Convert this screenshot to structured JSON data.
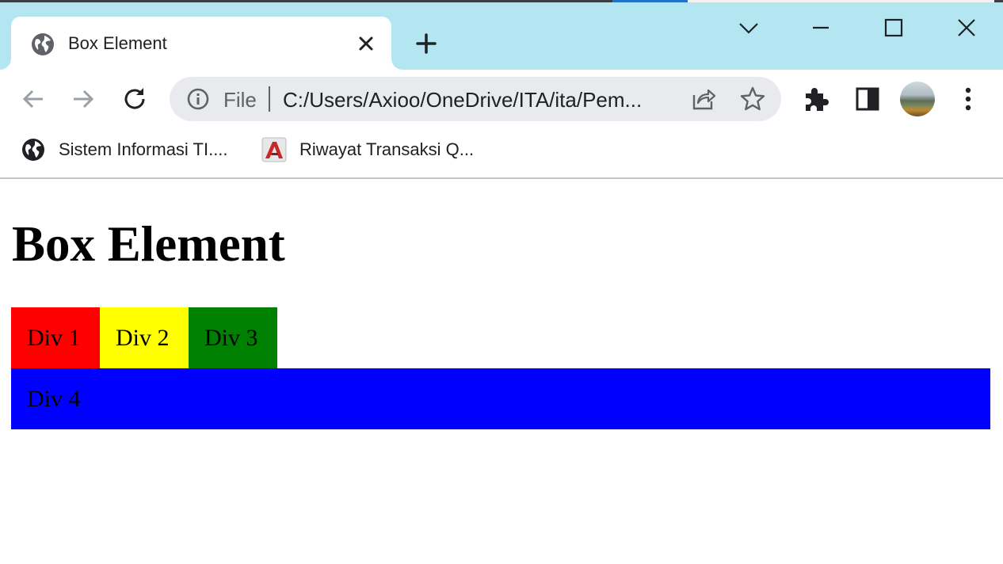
{
  "browser": {
    "tab": {
      "title": "Box Element",
      "favicon": "globe-icon"
    },
    "new_tab_icon": "plus-icon",
    "window_controls": [
      "chevron-down-icon",
      "minimize-icon",
      "maximize-icon",
      "close-icon"
    ],
    "address_bar": {
      "scheme_label": "File",
      "url": "C:/Users/Axioo/OneDrive/ITA/ita/Pem..."
    },
    "bookmarks": [
      {
        "label": "Sistem Informasi TI....",
        "icon": "globe-icon"
      },
      {
        "label": "Riwayat Transaksi Q...",
        "icon": "red-logo-icon"
      }
    ],
    "colors": {
      "frame": "#b4e6f2",
      "omnibox": "#e8eaed"
    }
  },
  "page": {
    "heading": "Box Element",
    "boxes": [
      {
        "label": "Div 1",
        "color": "#ff0000"
      },
      {
        "label": "Div 2",
        "color": "#ffff00"
      },
      {
        "label": "Div 3",
        "color": "#008000"
      },
      {
        "label": "Div 4",
        "color": "#0000ff"
      }
    ]
  }
}
